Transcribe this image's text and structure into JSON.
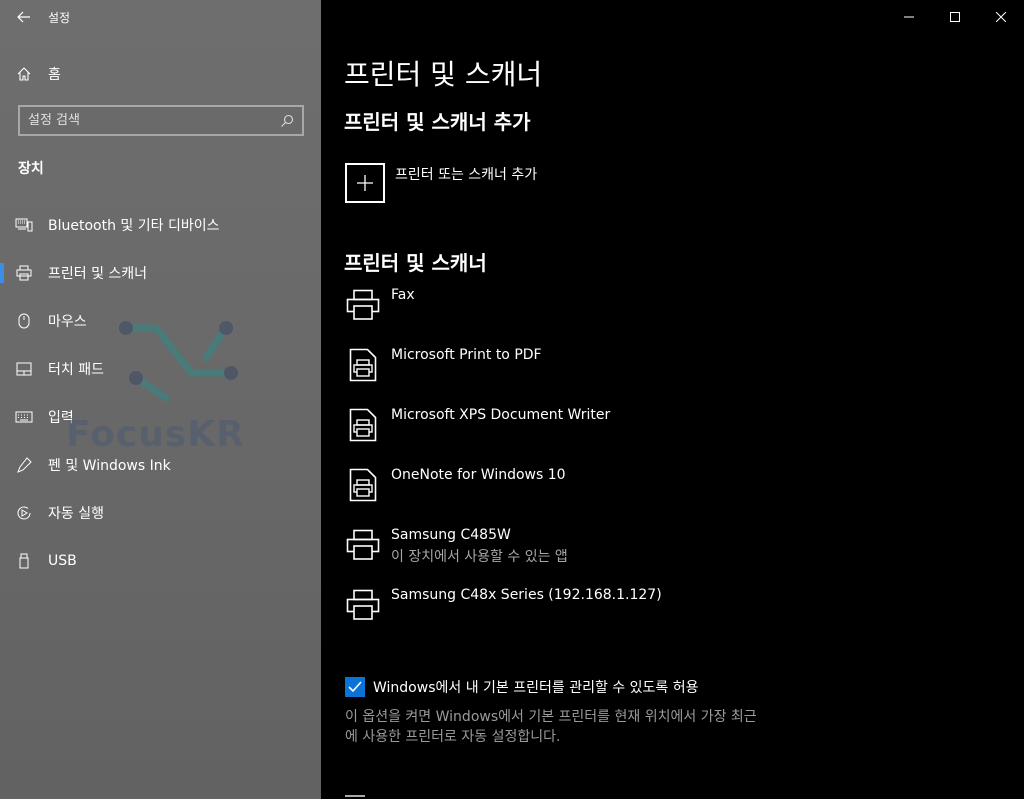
{
  "app": {
    "title": "설정"
  },
  "sidebar": {
    "home_label": "홈",
    "search_placeholder": "설정 검색",
    "section": "장치",
    "items": [
      {
        "label": "Bluetooth 및 기타 디바이스",
        "icon": "bluetooth-devices-icon"
      },
      {
        "label": "프린터 및 스캐너",
        "icon": "printer-icon",
        "active": true
      },
      {
        "label": "마우스",
        "icon": "mouse-icon"
      },
      {
        "label": "터치 패드",
        "icon": "touchpad-icon"
      },
      {
        "label": "입력",
        "icon": "keyboard-icon"
      },
      {
        "label": "펜 및 Windows Ink",
        "icon": "pen-icon"
      },
      {
        "label": "자동 실행",
        "icon": "autoplay-icon"
      },
      {
        "label": "USB",
        "icon": "usb-icon"
      }
    ],
    "watermark": "FocusKR"
  },
  "main": {
    "title": "프린터 및 스캐너",
    "add_section_title": "프린터 및 스캐너 추가",
    "add_label": "프린터 또는 스캐너 추가",
    "list_title": "프린터 및 스캐너",
    "printers": [
      {
        "name": "Fax",
        "sub": "",
        "icon": "printer-icon"
      },
      {
        "name": "Microsoft Print to PDF",
        "sub": "",
        "icon": "document-printer-icon"
      },
      {
        "name": "Microsoft XPS Document Writer",
        "sub": "",
        "icon": "document-printer-icon"
      },
      {
        "name": "OneNote for Windows 10",
        "sub": "",
        "icon": "document-printer-icon"
      },
      {
        "name": "Samsung C485W",
        "sub": "이 장치에서 사용할 수 있는 앱",
        "icon": "printer-icon"
      },
      {
        "name": "Samsung C48x Series (192.168.1.127)",
        "sub": "",
        "icon": "printer-icon"
      }
    ],
    "default_printer_checkbox": {
      "label": "Windows에서 내 기본 프린터를 관리할 수 있도록 허용",
      "checked": true
    },
    "description_line1": "이 옵션을 켜면 Windows에서 기본 프린터를 현재 위치에서 가장 최근",
    "description_line2": "에 사용한 프린터로 자동 설정합니다."
  },
  "colors": {
    "accent": "#0a74d6",
    "sidebar_bg": "#6a6a6a",
    "main_bg": "#000000"
  }
}
